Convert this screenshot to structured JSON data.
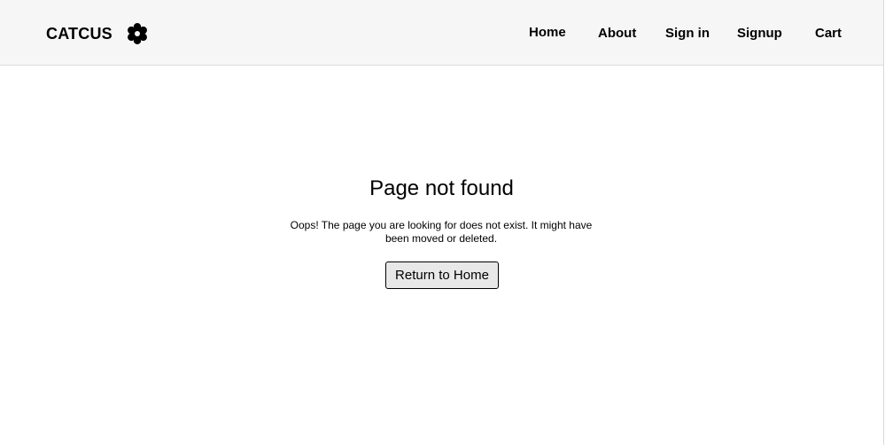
{
  "header": {
    "brand": "CATCUS",
    "brand_icon": "flower-icon",
    "nav": {
      "home": "Home",
      "about": "About",
      "signin": "Sign in",
      "signup": "Signup",
      "cart": "Cart"
    }
  },
  "main": {
    "title": "Page not found",
    "message": "Oops! The page you are looking for does not exist. It might have been moved or deleted.",
    "button": "Return to Home"
  },
  "colors": {
    "header_bg": "#f6f6f6",
    "button_bg": "#e8e8e8",
    "text": "#000000"
  }
}
